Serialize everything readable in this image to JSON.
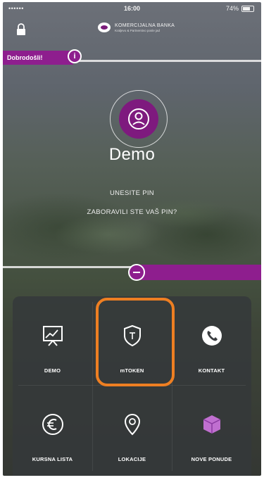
{
  "status_bar": {
    "carrier": "•••••• ",
    "time": "16:00",
    "battery": "74%"
  },
  "header": {
    "logo_line1": "KOMERCIJALNA BANKA",
    "logo_line2": "Kraljevo & Partnerstvo posle jad"
  },
  "welcome": {
    "label": "Dobrodošli!",
    "info_symbol": "i"
  },
  "profile": {
    "name": "Demo"
  },
  "links": {
    "enter_pin": "UNESITE PIN",
    "forgot_pin": "ZABORAVILI STE VAŠ PIN?"
  },
  "tiles": [
    {
      "label": "DEMO",
      "icon": "chart-easel-icon"
    },
    {
      "label": "mTOKEN",
      "icon": "shield-token-icon"
    },
    {
      "label": "KONTAKT",
      "icon": "phone-icon"
    },
    {
      "label": "KURSNA LISTA",
      "icon": "euro-icon"
    },
    {
      "label": "LOKACIJE",
      "icon": "location-pin-icon"
    },
    {
      "label": "NOVE PONUDE",
      "icon": "package-icon"
    }
  ],
  "colors": {
    "accent": "#8e1e8e",
    "highlight": "#ee7f22",
    "package": "#c06fd0"
  }
}
